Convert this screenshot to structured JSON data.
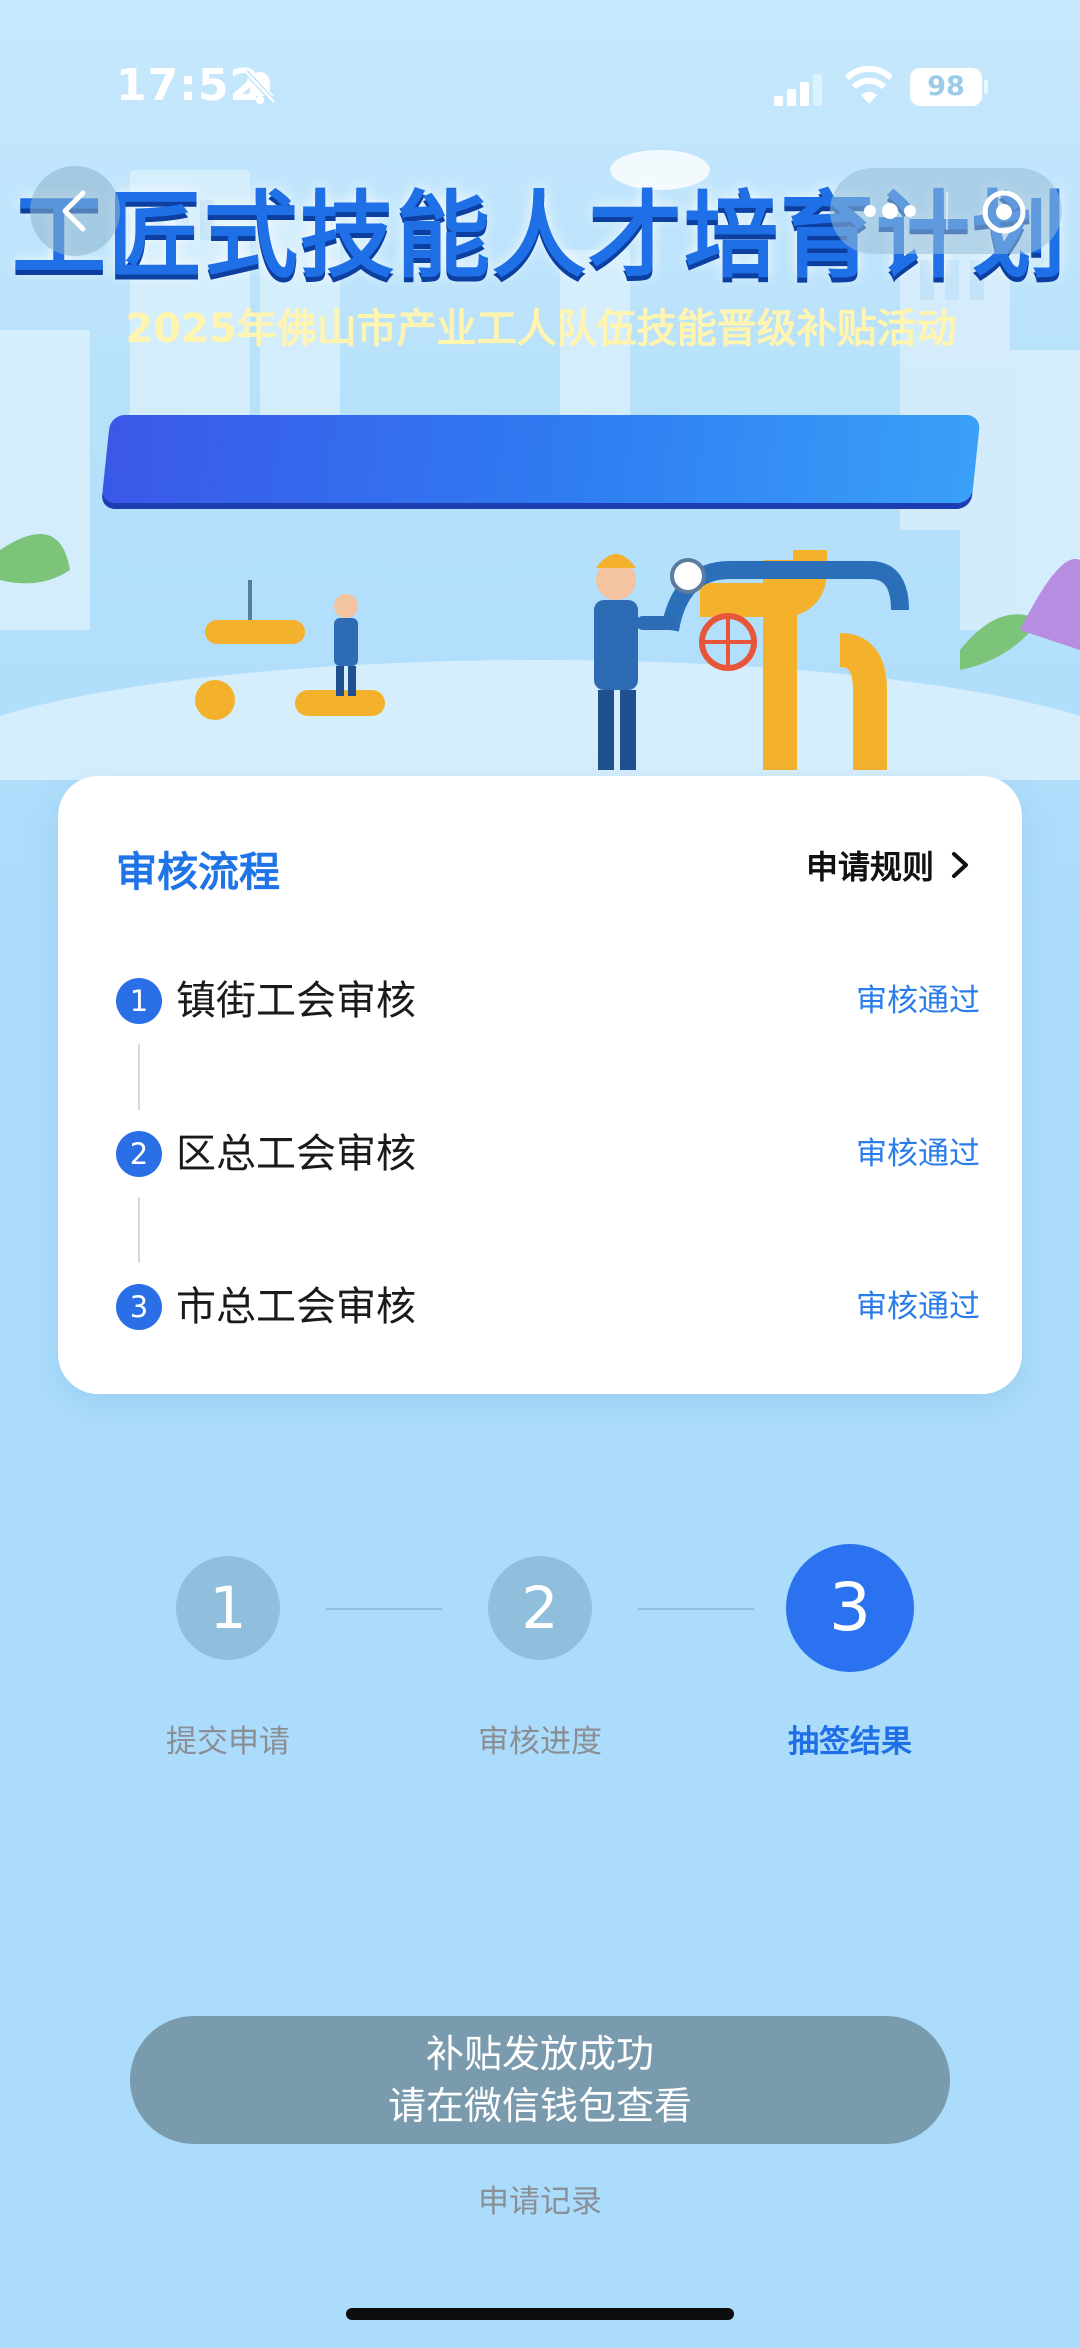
{
  "status_bar": {
    "time": "17:52",
    "battery": "98",
    "icons": [
      "bell-slash-icon",
      "signal-icon",
      "wifi-icon",
      "battery-icon"
    ]
  },
  "nav": {
    "back_icon": "chevron-left-icon",
    "more_icon": "more-dots-icon",
    "close_icon": "target-circle-icon"
  },
  "banner": {
    "title": "工匠式技能人才培育计划",
    "subtitle": "2025年佛山市产业工人队伍技能晋级补贴活动"
  },
  "review": {
    "title": "审核流程",
    "rules_label": "申请规则",
    "steps": [
      {
        "num": "1",
        "label": "镇街工会审核",
        "status": "审核通过"
      },
      {
        "num": "2",
        "label": "区总工会审核",
        "status": "审核通过"
      },
      {
        "num": "3",
        "label": "市总工会审核",
        "status": "审核通过"
      }
    ]
  },
  "progress": {
    "steps": [
      {
        "num": "1",
        "label": "提交申请",
        "active": false
      },
      {
        "num": "2",
        "label": "审核进度",
        "active": false
      },
      {
        "num": "3",
        "label": "抽签结果",
        "active": true
      }
    ]
  },
  "result_button": {
    "line1": "补贴发放成功",
    "line2": "请在微信钱包查看"
  },
  "records_link": "申请记录",
  "colors": {
    "accent": "#2a72f0",
    "background": "#abdcfb",
    "inactive_step": "#8fbfdc",
    "result_button": "#7a9aad",
    "status_text": "#2b7de9"
  }
}
